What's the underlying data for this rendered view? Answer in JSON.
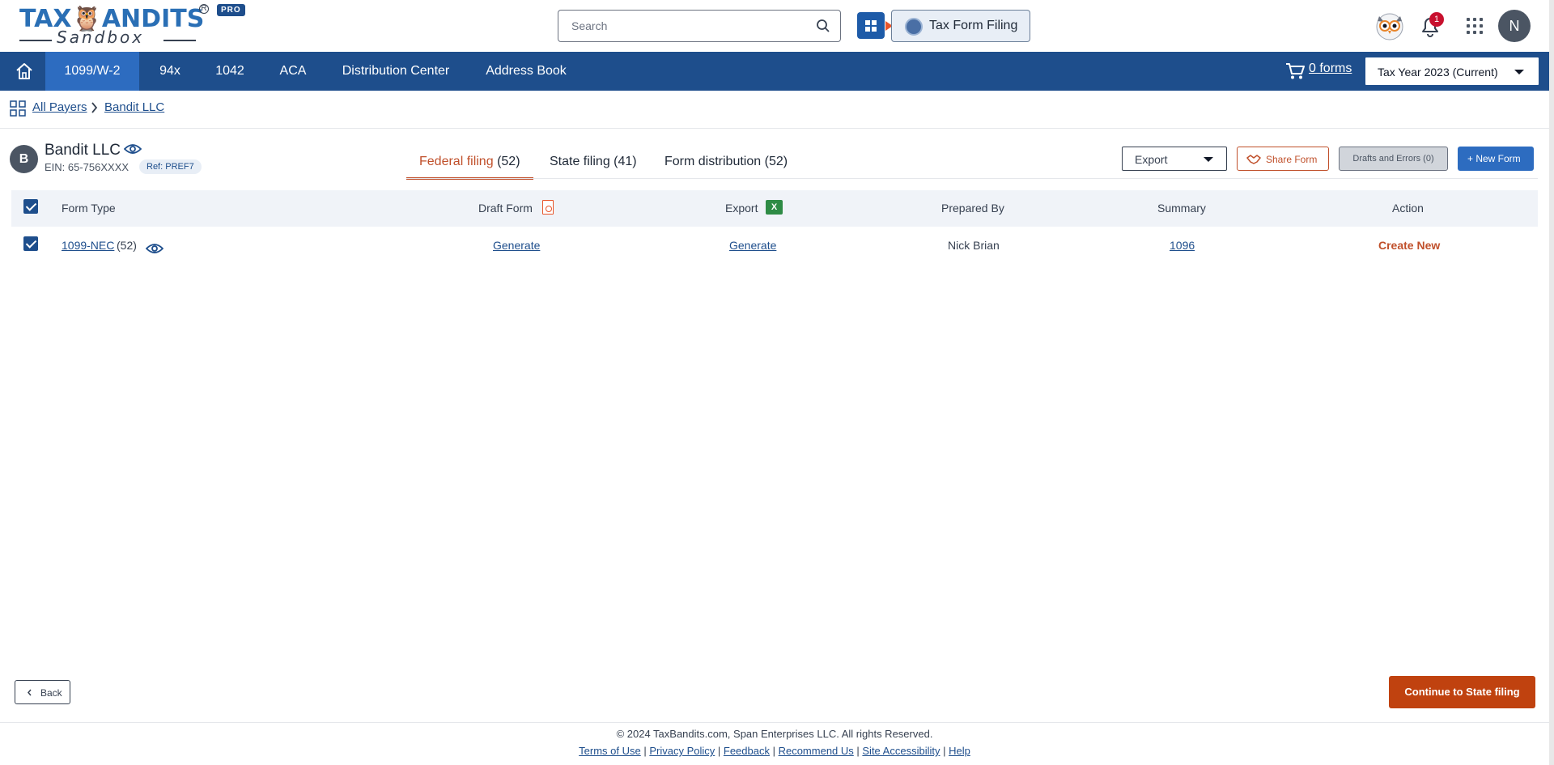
{
  "header": {
    "logo": {
      "brand": "TAXBANDITS",
      "sub": "Sandbox",
      "tier": "PRO",
      "reg": "R"
    },
    "search": {
      "placeholder": "Search",
      "value": ""
    },
    "product_switch_label": "Tax Form Filing",
    "notifications_count": "1",
    "user_initial": "N"
  },
  "nav": {
    "items": [
      {
        "label": "1099/W-2",
        "active": true
      },
      {
        "label": "94x"
      },
      {
        "label": "1042"
      },
      {
        "label": "ACA"
      },
      {
        "label": "Distribution Center"
      },
      {
        "label": "Address Book"
      }
    ],
    "cart_label": "0 forms",
    "tax_year": "Tax Year 2023 (Current)"
  },
  "breadcrumb": {
    "root": "All Payers",
    "current": "Bandit LLC"
  },
  "payer": {
    "initial": "B",
    "name": "Bandit LLC",
    "ein": "EIN: 65-756XXXX",
    "ref": "Ref: PREF7"
  },
  "tabs": [
    {
      "label": "Federal filing",
      "count": "(52)",
      "active": true
    },
    {
      "label": "State filing",
      "count": "(41)"
    },
    {
      "label": "Form distribution",
      "count": "(52)"
    }
  ],
  "toolbar": {
    "export_select": "Export",
    "share_label": "Share Form",
    "drafts_label": "Drafts and Errors (0)",
    "new_form_label": "+ New Form"
  },
  "table": {
    "headers": {
      "form_type": "Form Type",
      "draft_form": "Draft Form",
      "export": "Export",
      "prepared_by": "Prepared By",
      "summary": "Summary",
      "action": "Action"
    },
    "rows": [
      {
        "form_type": "1099-NEC",
        "count": "(52)",
        "draft_form": "Generate",
        "export": "Generate",
        "prepared_by": "Nick Brian",
        "summary": "1096",
        "action": "Create New"
      }
    ]
  },
  "footer": {
    "back_label": "Back",
    "continue_label": "Continue to State filing",
    "copyright": "© 2024 TaxBandits.com, Span Enterprises LLC. All rights Reserved.",
    "links": [
      "Terms of Use",
      "Privacy Policy",
      "Feedback",
      "Recommend Us",
      "Site Accessibility",
      "Help"
    ]
  },
  "colors": {
    "nav_bg": "#1e4e8c",
    "nav_active": "#2d6cc0",
    "accent_orange": "#c0502b",
    "continue_bg": "#c0420f"
  }
}
